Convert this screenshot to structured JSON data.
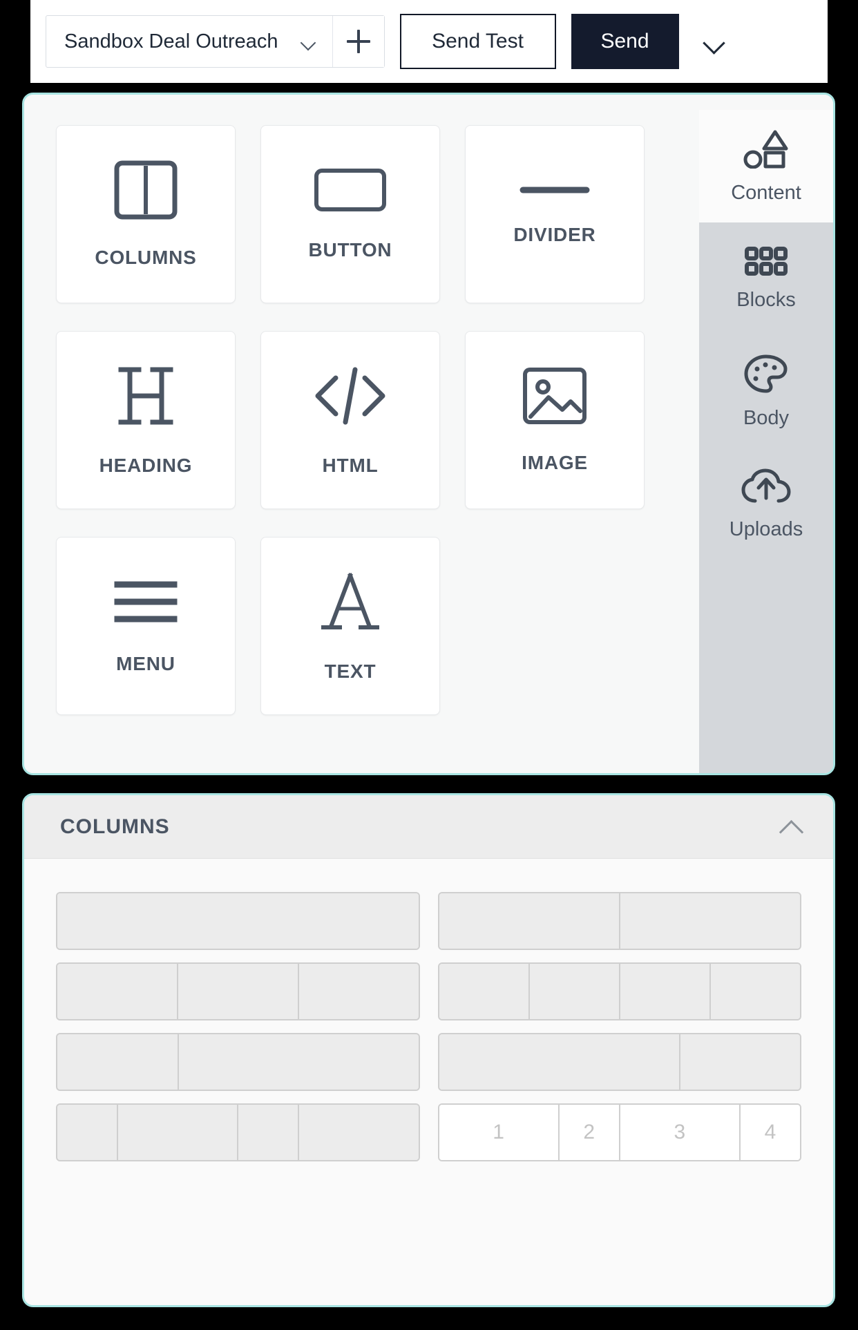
{
  "toolbar": {
    "campaign_name": "Sandbox Deal Outreach",
    "campaign_dropdown_icon": "chevron-down-icon",
    "add_campaign_icon": "plus-icon",
    "send_test_label": "Send Test",
    "send_label": "Send",
    "send_options_icon": "chevron-down-icon"
  },
  "content_panel": {
    "blocks": [
      {
        "label": "COLUMNS",
        "icon": "columns-icon"
      },
      {
        "label": "BUTTON",
        "icon": "button-icon"
      },
      {
        "label": "DIVIDER",
        "icon": "divider-icon"
      },
      {
        "label": "HEADING",
        "icon": "heading-icon"
      },
      {
        "label": "HTML",
        "icon": "code-icon"
      },
      {
        "label": "IMAGE",
        "icon": "image-icon"
      },
      {
        "label": "MENU",
        "icon": "menu-icon"
      },
      {
        "label": "TEXT",
        "icon": "text-icon"
      }
    ],
    "tabs": [
      {
        "label": "Content",
        "icon": "shapes-icon",
        "active": true
      },
      {
        "label": "Blocks",
        "icon": "grid-icon",
        "active": false
      },
      {
        "label": "Body",
        "icon": "palette-icon",
        "active": false
      },
      {
        "label": "Uploads",
        "icon": "cloud-upload-icon",
        "active": false
      }
    ]
  },
  "columns_panel": {
    "title": "COLUMNS",
    "collapse_icon": "chevron-up-icon",
    "layouts": [
      {
        "name": "one-column",
        "cells": [
          {
            "flex": 1,
            "label": ""
          }
        ],
        "highlight": false
      },
      {
        "name": "two-columns-equal",
        "cells": [
          {
            "flex": 1,
            "label": ""
          },
          {
            "flex": 1,
            "label": ""
          }
        ],
        "highlight": false
      },
      {
        "name": "three-columns-equal",
        "cells": [
          {
            "flex": 1,
            "label": ""
          },
          {
            "flex": 1,
            "label": ""
          },
          {
            "flex": 1,
            "label": ""
          }
        ],
        "highlight": false
      },
      {
        "name": "four-columns-equal",
        "cells": [
          {
            "flex": 1,
            "label": ""
          },
          {
            "flex": 1,
            "label": ""
          },
          {
            "flex": 1,
            "label": ""
          },
          {
            "flex": 1,
            "label": ""
          }
        ],
        "highlight": false
      },
      {
        "name": "two-columns-one-third-two-thirds",
        "cells": [
          {
            "flex": 1,
            "label": ""
          },
          {
            "flex": 2,
            "label": ""
          }
        ],
        "highlight": false
      },
      {
        "name": "two-columns-two-thirds-one-third",
        "cells": [
          {
            "flex": 2,
            "label": ""
          },
          {
            "flex": 1,
            "label": ""
          }
        ],
        "highlight": false
      },
      {
        "name": "four-columns-mixed",
        "cells": [
          {
            "flex": 1,
            "label": ""
          },
          {
            "flex": 2,
            "label": ""
          },
          {
            "flex": 1,
            "label": ""
          },
          {
            "flex": 2,
            "label": ""
          }
        ],
        "highlight": false
      },
      {
        "name": "four-columns-numbered",
        "cells": [
          {
            "flex": 2,
            "label": "1"
          },
          {
            "flex": 1,
            "label": "2"
          },
          {
            "flex": 2,
            "label": "3"
          },
          {
            "flex": 1,
            "label": "4"
          }
        ],
        "highlight": true
      }
    ]
  },
  "colors": {
    "panel_border": "#a8e4e2",
    "send_button_bg": "#141b2d",
    "tab_inactive_bg": "#d4d7db",
    "icon": "#4b5563",
    "page_bg": "#000000"
  }
}
